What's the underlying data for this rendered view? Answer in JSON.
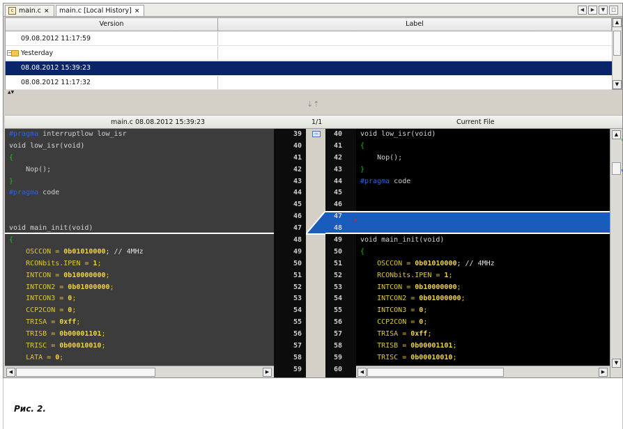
{
  "tabs": [
    {
      "label": "main.c",
      "close": "×"
    },
    {
      "label": "main.c [Local History]",
      "close": "×"
    }
  ],
  "nav_buttons": [
    "◀",
    "▶",
    "▼",
    "□"
  ],
  "history": {
    "columns": [
      "Version",
      "Label"
    ],
    "rows": [
      {
        "kind": "entry",
        "version": "09.08.2012 11:17:59",
        "label": ""
      },
      {
        "kind": "group",
        "version": "Yesterday",
        "label": ""
      },
      {
        "kind": "entry",
        "version": "08.08.2012 15:39:23",
        "label": "",
        "selected": true
      },
      {
        "kind": "entry",
        "version": "08.08.2012 11:17:32",
        "label": ""
      }
    ]
  },
  "diff_header": {
    "left": "main.c 08.08.2012 15:39:23",
    "middle": "1/1",
    "right": "Current File"
  },
  "left_lines": [
    {
      "num": "39",
      "code": [
        [
          "pp",
          "#pragma"
        ],
        [
          "id",
          " interruptlow low_isr"
        ]
      ]
    },
    {
      "num": "40",
      "code": [
        [
          "fn",
          "void low_isr(void)"
        ]
      ]
    },
    {
      "num": "41",
      "code": [
        [
          "br",
          "{"
        ]
      ]
    },
    {
      "num": "42",
      "code": [
        [
          "id",
          "    Nop();"
        ]
      ]
    },
    {
      "num": "43",
      "code": [
        [
          "br",
          "}"
        ]
      ]
    },
    {
      "num": "44",
      "code": [
        [
          "pp",
          "#pragma"
        ],
        [
          "id",
          " code"
        ]
      ]
    },
    {
      "num": "45",
      "code": []
    },
    {
      "num": "46",
      "code": []
    },
    {
      "num": "47",
      "code": [
        [
          "fn",
          "void main_init(void)"
        ]
      ]
    },
    {
      "num": "48",
      "code": [
        [
          "br",
          "{"
        ]
      ]
    },
    {
      "num": "49",
      "code": [
        [
          "reg",
          "    OSCCON = "
        ],
        [
          "num",
          "0b01010000"
        ],
        [
          "cm",
          "; // 4MHz"
        ]
      ]
    },
    {
      "num": "50",
      "code": [
        [
          "reg",
          "    RCONbits.IPEN = "
        ],
        [
          "num",
          "1"
        ],
        [
          "reg",
          ";"
        ]
      ]
    },
    {
      "num": "51",
      "code": [
        [
          "reg",
          "    INTCON = "
        ],
        [
          "num",
          "0b10000000"
        ],
        [
          "reg",
          ";"
        ]
      ]
    },
    {
      "num": "52",
      "code": [
        [
          "reg",
          "    INTCON2 = "
        ],
        [
          "num",
          "0b01000000"
        ],
        [
          "reg",
          ";"
        ]
      ]
    },
    {
      "num": "53",
      "code": [
        [
          "reg",
          "    INTCON3 = "
        ],
        [
          "num",
          "0"
        ],
        [
          "reg",
          ";"
        ]
      ]
    },
    {
      "num": "54",
      "code": [
        [
          "reg",
          "    CCP2CON = "
        ],
        [
          "num",
          "0"
        ],
        [
          "reg",
          ";"
        ]
      ]
    },
    {
      "num": "55",
      "code": [
        [
          "reg",
          "    TRISA = "
        ],
        [
          "num",
          "0xff"
        ],
        [
          "reg",
          ";"
        ]
      ]
    },
    {
      "num": "56",
      "code": [
        [
          "reg",
          "    TRISB = "
        ],
        [
          "num",
          "0b00001101"
        ],
        [
          "reg",
          ";"
        ]
      ]
    },
    {
      "num": "57",
      "code": [
        [
          "reg",
          "    TRISC = "
        ],
        [
          "num",
          "0b00010010"
        ],
        [
          "reg",
          ";"
        ]
      ]
    },
    {
      "num": "58",
      "code": [
        [
          "reg",
          "    LATA = "
        ],
        [
          "num",
          "0"
        ],
        [
          "reg",
          ";"
        ]
      ]
    },
    {
      "num": "59",
      "code": []
    }
  ],
  "right_lines": [
    {
      "num": "40",
      "code": [
        [
          "fn",
          "void low_isr(void)"
        ]
      ]
    },
    {
      "num": "41",
      "code": [
        [
          "br",
          "{"
        ]
      ]
    },
    {
      "num": "42",
      "code": [
        [
          "id",
          "    Nop();"
        ]
      ]
    },
    {
      "num": "43",
      "code": [
        [
          "br",
          "}"
        ]
      ]
    },
    {
      "num": "44",
      "code": [
        [
          "pp",
          "#pragma"
        ],
        [
          "id",
          " code"
        ]
      ]
    },
    {
      "num": "45",
      "code": []
    },
    {
      "num": "46",
      "code": []
    },
    {
      "num": "47",
      "code": []
    },
    {
      "num": "48",
      "code": []
    },
    {
      "num": "49",
      "code": [
        [
          "fn",
          "void main_init(void)"
        ]
      ]
    },
    {
      "num": "50",
      "code": [
        [
          "br",
          "{"
        ]
      ]
    },
    {
      "num": "51",
      "code": [
        [
          "reg",
          "    OSCCON = "
        ],
        [
          "num",
          "0b01010000"
        ],
        [
          "cm",
          "; // 4MHz"
        ]
      ]
    },
    {
      "num": "52",
      "code": [
        [
          "reg",
          "    RCONbits.IPEN = "
        ],
        [
          "num",
          "1"
        ],
        [
          "reg",
          ";"
        ]
      ]
    },
    {
      "num": "53",
      "code": [
        [
          "reg",
          "    INTCON = "
        ],
        [
          "num",
          "0b10000000"
        ],
        [
          "reg",
          ";"
        ]
      ]
    },
    {
      "num": "54",
      "code": [
        [
          "reg",
          "    INTCON2 = "
        ],
        [
          "num",
          "0b01000000"
        ],
        [
          "reg",
          ";"
        ]
      ]
    },
    {
      "num": "55",
      "code": [
        [
          "reg",
          "    INTCON3 = "
        ],
        [
          "num",
          "0"
        ],
        [
          "reg",
          ";"
        ]
      ]
    },
    {
      "num": "56",
      "code": [
        [
          "reg",
          "    CCP2CON = "
        ],
        [
          "num",
          "0"
        ],
        [
          "reg",
          ";"
        ]
      ]
    },
    {
      "num": "57",
      "code": [
        [
          "reg",
          "    TRISA = "
        ],
        [
          "num",
          "0xff"
        ],
        [
          "reg",
          ";"
        ]
      ]
    },
    {
      "num": "58",
      "code": [
        [
          "reg",
          "    TRISB = "
        ],
        [
          "num",
          "0b00001101"
        ],
        [
          "reg",
          ";"
        ]
      ]
    },
    {
      "num": "59",
      "code": [
        [
          "reg",
          "    TRISC = "
        ],
        [
          "num",
          "0b00010010"
        ],
        [
          "reg",
          ";"
        ]
      ]
    },
    {
      "num": "60",
      "code": []
    }
  ],
  "diff_marker": "×",
  "colors": {
    "selection": "#0a246a",
    "diff_highlight": "#1a5cbc",
    "preprocessor": "#2f64d8",
    "register": "#e0c63a",
    "number": "#f0d24a",
    "brace": "#19c419",
    "left_pane_bg": "#3c3c3c",
    "right_pane_bg": "#000000"
  },
  "caption": "Рис. 2."
}
